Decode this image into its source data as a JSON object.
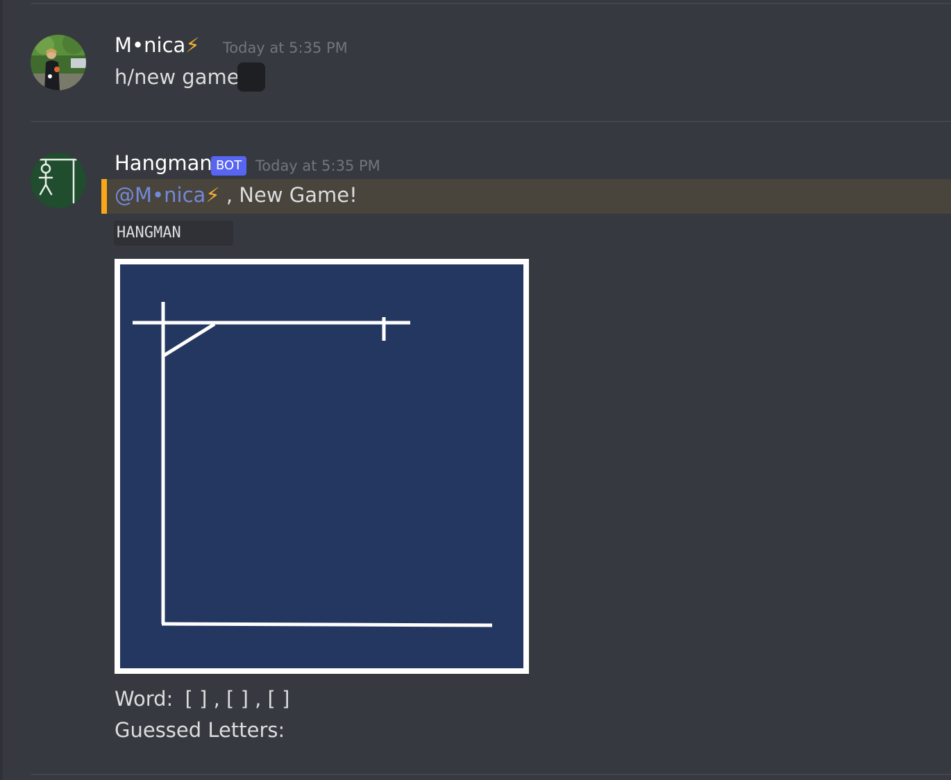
{
  "messages": [
    {
      "username": "M•nica",
      "username_emoji": "⚡",
      "timestamp": "Today at 5:35 PM",
      "text": "h/new game"
    },
    {
      "username": "Hangman",
      "badge": "BOT",
      "timestamp": "Today at 5:35 PM",
      "mention": "@M•nica",
      "mention_emoji": "⚡",
      "reply": ", New Game!",
      "code_label": "HANGMAN",
      "word_label": "Word:",
      "word_value": "[ ] , [ ] , [ ]",
      "guessed_label": "Guessed Letters:"
    }
  ],
  "colors": {
    "background": "#36393f",
    "mention_highlight": "#49443c",
    "mention_bar": "#faa81a",
    "mention_text": "#7289da",
    "bot_badge": "#5865f2",
    "board": "#243761"
  }
}
